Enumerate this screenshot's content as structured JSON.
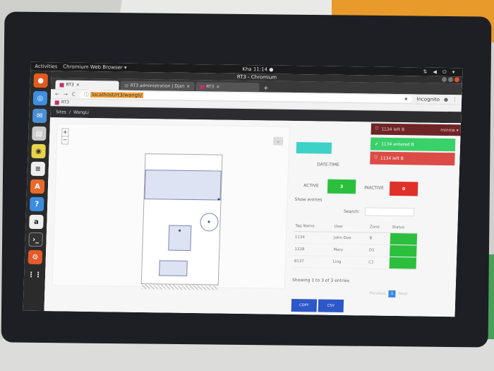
{
  "topbar": {
    "activities": "Activities",
    "app": "Chromium Web Browser ▾",
    "clock": "Kha 11:14 ●"
  },
  "window": {
    "title": "RT3 - Chromium"
  },
  "tabs": [
    {
      "label": "RT3"
    },
    {
      "label": "RT3 administration | Djan"
    },
    {
      "label": "RT3"
    }
  ],
  "omnibox": {
    "url": "localhost/rt3/wangli/",
    "mode": "Incognito"
  },
  "bookmarks": {
    "item": "RT3"
  },
  "breadcrumb": {
    "root": "Sites",
    "sep": "/",
    "current": "WangLi"
  },
  "map": {
    "zoom_in": "+",
    "zoom_out": "−"
  },
  "panel": {
    "datetime_label": "DATE-TIME",
    "active_label": "ACTIVE",
    "active_value": "3",
    "inactive_label": "INACTIVE",
    "inactive_value": "0",
    "show_entries": "Show entries",
    "search_label": "Search:",
    "showing": "Showing 1 to 3 of 3 entries",
    "copy": "COPY",
    "csv": "CSV",
    "previous": "Previous",
    "page": "1",
    "next": "Next"
  },
  "table": {
    "headers": [
      "Tag Name",
      "User",
      "Zone",
      "Status"
    ],
    "rows": [
      [
        "1134",
        "John Doe",
        "B"
      ],
      [
        "1228",
        "Mary",
        "D1"
      ],
      [
        "8137",
        "Ling",
        "C1"
      ]
    ]
  },
  "notifications": {
    "top": {
      "text": "1134 left B",
      "user": "minnie ▾"
    },
    "green": "1134 entered B",
    "red": "1134 left B"
  },
  "colors": {
    "active": "#2cbf3e",
    "inactive": "#e0302a",
    "accent": "#3ed1c8"
  }
}
